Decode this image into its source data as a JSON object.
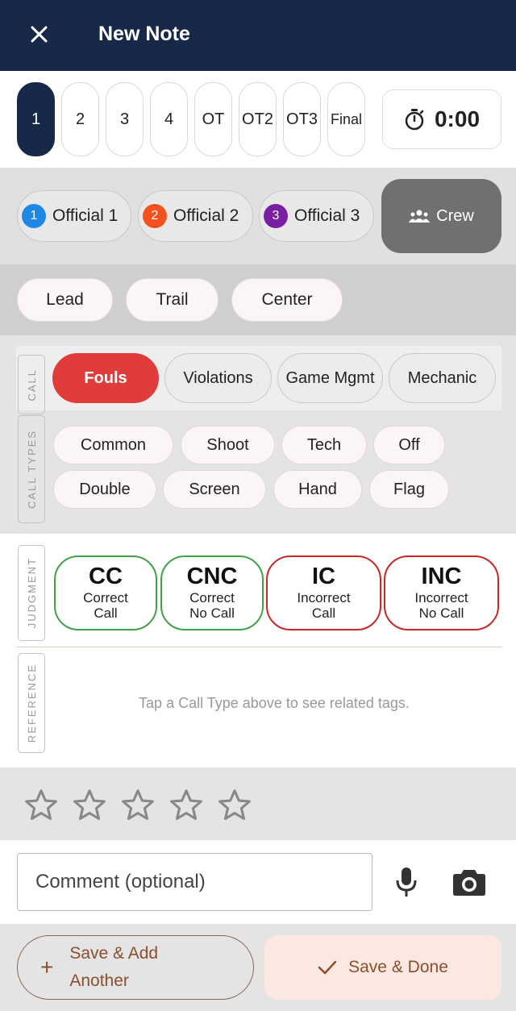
{
  "header": {
    "title": "New Note",
    "close_icon": "close-icon"
  },
  "periods": [
    "1",
    "2",
    "3",
    "4",
    "OT",
    "OT2",
    "OT3",
    "Final"
  ],
  "timer": {
    "value": "0:00",
    "icon": "stopwatch-icon"
  },
  "officials": [
    {
      "num": "1",
      "label": "Official 1",
      "color": "#1e88e5"
    },
    {
      "num": "2",
      "label": "Official 2",
      "color": "#f4511e"
    },
    {
      "num": "3",
      "label": "Official 3",
      "color": "#7b1fa2"
    }
  ],
  "crew": {
    "label": "Crew",
    "icon": "group-icon"
  },
  "positions": [
    "Lead",
    "Trail",
    "Center"
  ],
  "call_section": {
    "label": "CALL",
    "items": [
      "Fouls",
      "Violations",
      "Game Mgmt",
      "Mechanic"
    ],
    "selected": "Fouls"
  },
  "call_types": {
    "label": "CALL TYPES",
    "items": [
      "Common",
      "Shoot",
      "Tech",
      "Off",
      "Double",
      "Screen",
      "Hand",
      "Flag"
    ]
  },
  "judgment": {
    "label": "JUDGMENT",
    "items": [
      {
        "code": "CC",
        "line1": "Correct",
        "line2": "Call"
      },
      {
        "code": "CNC",
        "line1": "Correct",
        "line2": "No Call"
      },
      {
        "code": "IC",
        "line1": "Incorrect",
        "line2": "Call"
      },
      {
        "code": "INC",
        "line1": "Incorrect",
        "line2": "No Call"
      }
    ]
  },
  "reference": {
    "label": "REFERENCE",
    "hint": "Tap a Call Type above to see related tags."
  },
  "rating": {
    "max": 5,
    "value": 0
  },
  "comment": {
    "placeholder": "Comment (optional)",
    "mic_icon": "mic-icon",
    "camera_icon": "camera-icon"
  },
  "footer": {
    "save_add_line1": "Save & Add",
    "save_add_line2": "Another",
    "save_done": "Save & Done"
  },
  "colors": {
    "header": "#172849",
    "selected_call": "#e03c3c",
    "correct": "#43a047",
    "incorrect": "#c62828",
    "action": "#8a4f30"
  }
}
